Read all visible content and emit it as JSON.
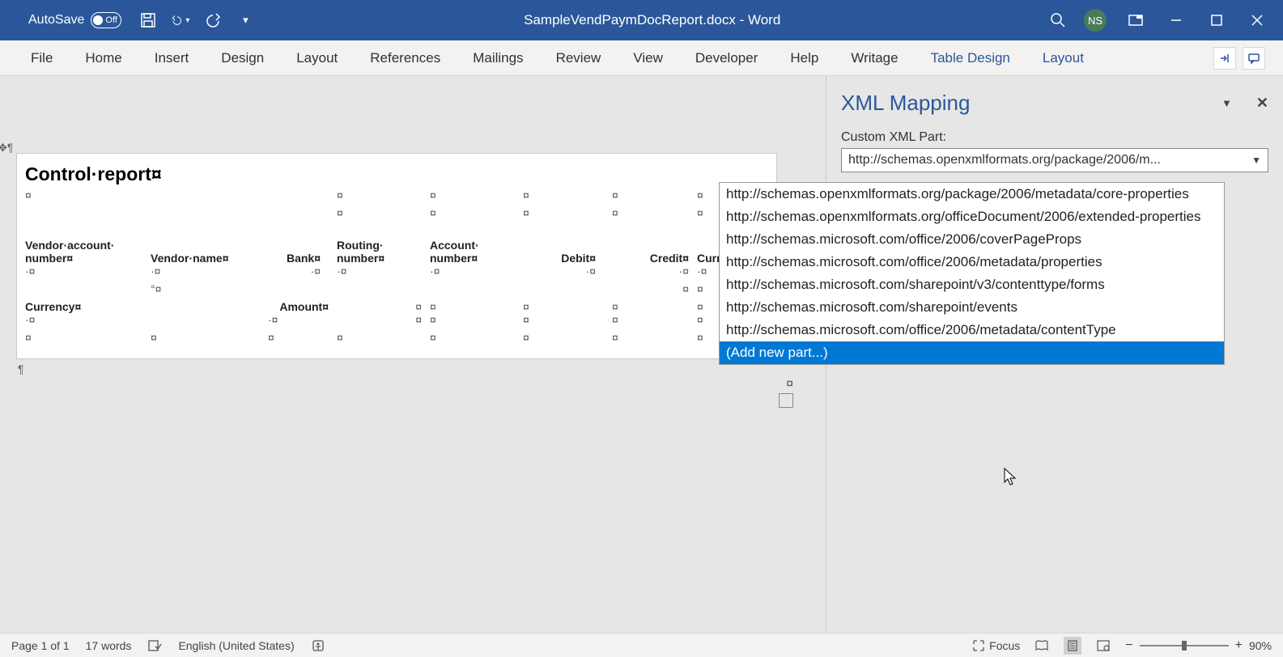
{
  "titlebar": {
    "autosave_label": "AutoSave",
    "autosave_state": "Off",
    "doc_title": "SampleVendPaymDocReport.docx - Word",
    "user_initials": "NS"
  },
  "ribbon": {
    "tabs": [
      "File",
      "Home",
      "Insert",
      "Design",
      "Layout",
      "References",
      "Mailings",
      "Review",
      "View",
      "Developer",
      "Help",
      "Writage",
      "Table Design",
      "Layout"
    ]
  },
  "document": {
    "title": "Control·report¤",
    "headers_row1": [
      "Vendor·account·",
      "",
      "",
      "Routing·",
      "Account·",
      "",
      "",
      ""
    ],
    "headers_row2": [
      "number¤",
      "Vendor·name¤",
      "Bank¤",
      "number¤",
      "number¤",
      "Debit¤",
      "Credit¤",
      "Curre"
    ],
    "row3": [
      "Currency¤",
      "",
      "Amount¤",
      "",
      "",
      "",
      "",
      ""
    ]
  },
  "pane": {
    "title": "XML Mapping",
    "label": "Custom XML Part:",
    "selected": "http://schemas.openxmlformats.org/package/2006/m...",
    "items": [
      "http://schemas.openxmlformats.org/package/2006/metadata/core-properties",
      "http://schemas.openxmlformats.org/officeDocument/2006/extended-properties",
      "http://schemas.microsoft.com/office/2006/coverPageProps",
      "http://schemas.microsoft.com/office/2006/metadata/properties",
      "http://schemas.microsoft.com/sharepoint/v3/contenttype/forms",
      "http://schemas.microsoft.com/sharepoint/events",
      "http://schemas.microsoft.com/office/2006/metadata/contentType",
      "(Add new part...)"
    ]
  },
  "statusbar": {
    "page": "Page 1 of 1",
    "words": "17 words",
    "language": "English (United States)",
    "focus": "Focus",
    "zoom": "90%"
  }
}
